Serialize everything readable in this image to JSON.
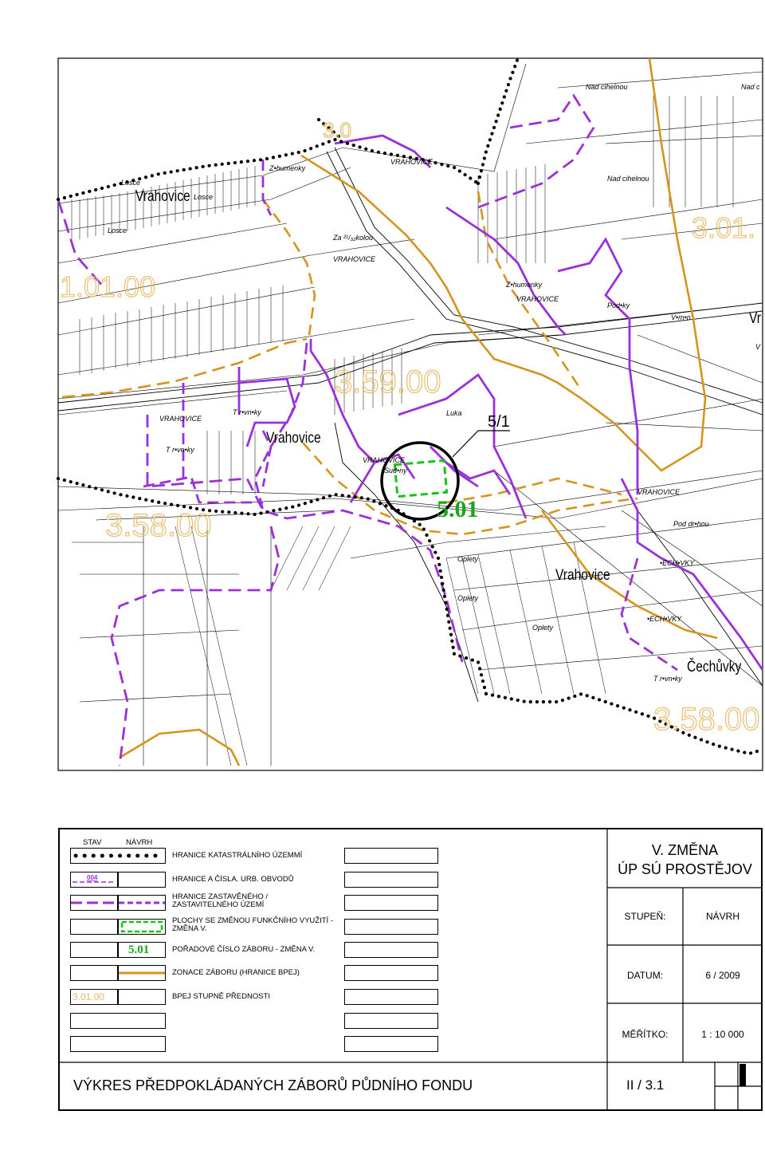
{
  "map": {
    "place_labels": [
      {
        "text": "Vrahovice",
        "style": "large"
      },
      {
        "text": "Losce",
        "style": "small-italic"
      },
      {
        "text": "Losce",
        "style": "small-italic"
      },
      {
        "text": "Losce",
        "style": "small-italic"
      },
      {
        "text": "Z•humenky",
        "style": "small-italic"
      },
      {
        "text": "VRAHOVICE",
        "style": "small-italic"
      },
      {
        "text": "Za ²¹/₃₂kolou",
        "style": "small-italic"
      },
      {
        "text": "VRAHOVICE",
        "style": "small-italic"
      },
      {
        "text": "Nad cihelnou",
        "style": "small-italic"
      },
      {
        "text": "Nad c",
        "style": "small-italic"
      },
      {
        "text": "Nad cihelnou",
        "style": "small-italic"
      },
      {
        "text": "Z•humenky",
        "style": "small-italic"
      },
      {
        "text": "VRAHOVICE",
        "style": "small-italic"
      },
      {
        "text": "Pod•ky",
        "style": "small-italic"
      },
      {
        "text": "V•m•n",
        "style": "small-italic"
      },
      {
        "text": "Vr",
        "style": "large"
      },
      {
        "text": "V",
        "style": "small-italic"
      },
      {
        "text": "VRAHOVICE",
        "style": "small-italic"
      },
      {
        "text": "T r•vn•ky",
        "style": "small-italic"
      },
      {
        "text": "T r•vn•ky",
        "style": "small-italic"
      },
      {
        "text": "Vrahovice",
        "style": "large"
      },
      {
        "text": "Luka",
        "style": "small-italic"
      },
      {
        "text": "VRAHOVICE",
        "style": "small-italic"
      },
      {
        "text": "Sud•ny",
        "style": "small-italic"
      },
      {
        "text": "VRAHOVICE",
        "style": "small-italic"
      },
      {
        "text": "Pod dr•hou",
        "style": "small-italic"
      },
      {
        "text": "•ECH•VKY",
        "style": "small-italic"
      },
      {
        "text": "Oplety",
        "style": "small-italic"
      },
      {
        "text": "Oplety",
        "style": "small-italic"
      },
      {
        "text": "Oplety",
        "style": "small-italic"
      },
      {
        "text": "Vrahovice",
        "style": "large"
      },
      {
        "text": "•ECH•VKY",
        "style": "small-italic"
      },
      {
        "text": "Čechůvky",
        "style": "large"
      },
      {
        "text": "T r•vn•ky",
        "style": "small-italic"
      }
    ],
    "bpej_labels": [
      "3.0",
      "3.01.",
      "1.01.00",
      "3.59.00",
      "3.58.00",
      "3.58.00"
    ],
    "parcel_label": "5/1",
    "zabor_label": "5.01",
    "colors": {
      "cadastral_boundary": "#000000",
      "urban_boundary": "#9b30d9",
      "built_up_boundary": "#9b30d9",
      "change_area": "#19c219",
      "zabor_number": "#19a519",
      "bpej_line": "#d4941e",
      "bpej_text": "#e7b863"
    }
  },
  "legend": {
    "header_stav": "STAV",
    "header_navrh": "NÁVRH",
    "items": [
      {
        "text": "HRANICE KATASTRÁLNÍHO ÚZEMMÍ",
        "icon": "dotted-boundary-icon"
      },
      {
        "text": "HRANICE A ČÍSLA. URB. OBVODŮ",
        "icon": "urban-district-icon",
        "sample": "004"
      },
      {
        "text": "HRANICE ZASTAVĚNÉHO / ZASTAVITELNÉHO ÚZEMÍ",
        "icon": "built-up-boundary-icon"
      },
      {
        "text": "PLOCHY SE ZMĚNOU FUNKČNÍHO VYUŽITÍ - ZMĚNA V.",
        "icon": "change-area-icon"
      },
      {
        "text": "POŘADOVÉ ČÍSLO ZÁBORU - ZMĚNA V.",
        "icon": "zabor-number-icon",
        "sample": "5.01"
      },
      {
        "text": "ZONACE ZÁBORU (HRANICE BPEJ)",
        "icon": "bpej-line-icon"
      },
      {
        "text": "BPEJ STUPNĚ PŘEDNOSTI",
        "icon": "bpej-code-icon",
        "sample": "3.01.00"
      }
    ]
  },
  "titleblock": {
    "change_title": "V. ZMĚNA",
    "plan_title": "ÚP SÚ PROSTĚJOV",
    "stage_label": "STUPEŇ:",
    "stage_value": "NÁVRH",
    "date_label": "DATUM:",
    "date_value": "6 / 2009",
    "scale_label": "MĚŘÍTKO:",
    "scale_value": "1 : 10 000",
    "drawing_title": "VÝKRES PŘEDPOKLÁDANÝCH ZÁBORŮ PŮDNÍHO FONDU",
    "drawing_number": "II / 3.1"
  }
}
